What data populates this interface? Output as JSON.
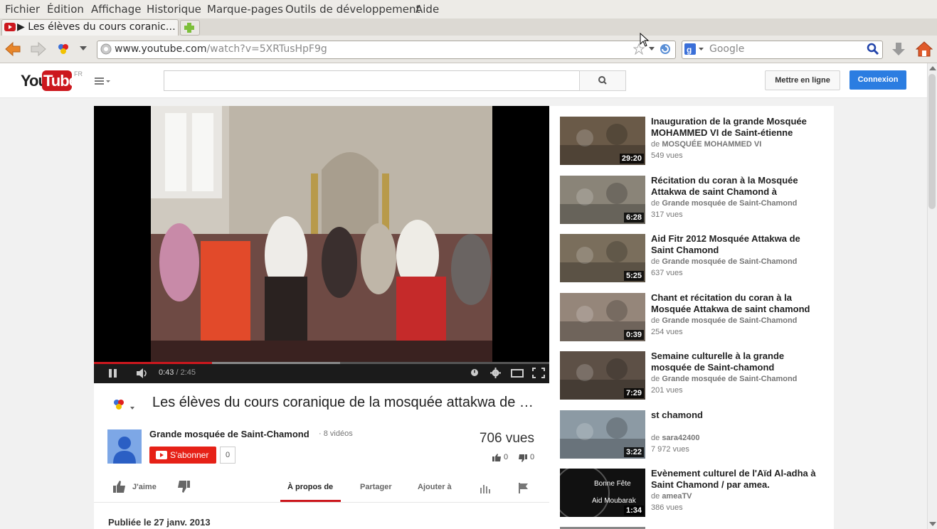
{
  "menubar": [
    "Fichier",
    "Édition",
    "Affichage",
    "Historique",
    "Marque-pages",
    "Outils de développement",
    "Aide"
  ],
  "tab": {
    "title": "▶ Les élèves du cours coranic…"
  },
  "navbar": {
    "url_host": "www.youtube.com",
    "url_path": "/watch?v=5XRTusHpF9g",
    "search_placeholder": "Google"
  },
  "yt": {
    "logo_you": "You",
    "logo_tube": "Tube",
    "region": "FR",
    "upload": "Mettre en ligne",
    "login": "Connexion"
  },
  "player": {
    "current": "0:43",
    "duration": "/ 2:45",
    "progress": 0.26,
    "buffered": 0.54
  },
  "video": {
    "title": "Les élèves du cours coranique de la mosquée attakwa de saint chamond",
    "channel": "Grande mosquée de Saint-Chamond",
    "video_count": "· 8 vidéos",
    "subscribe": "S'abonner",
    "sub_count": "0",
    "views": "706 vues",
    "likes": "0",
    "dislikes": "0",
    "like_label": "J'aime",
    "tabs": [
      "À propos de",
      "Partager",
      "Ajouter à"
    ],
    "published": "Publiée le 27 janv. 2013"
  },
  "recs": [
    {
      "title": "Inauguration de la grande Mosquée MOHAMMED VI de Saint-étienne",
      "by_prefix": "de",
      "by": "MOSQUÉE MOHAMMED VI",
      "views": "549 vues",
      "duration": "29:20",
      "thumb": "#6a5a48"
    },
    {
      "title": "Récitation du coran à la Mosquée Attakwa de saint Chamond à",
      "by_prefix": "de",
      "by": "Grande mosquée de Saint-Chamond",
      "views": "317 vues",
      "duration": "6:28",
      "thumb": "#8a8478"
    },
    {
      "title": "Aid Fitr 2012 Mosquée Attakwa de Saint Chamond",
      "by_prefix": "de",
      "by": "Grande mosquée de Saint-Chamond",
      "views": "637 vues",
      "duration": "5:25",
      "thumb": "#7a6e5c"
    },
    {
      "title": "Chant et récitation du coran à la Mosquée Attakwa de saint chamond",
      "by_prefix": "de",
      "by": "Grande mosquée de Saint-Chamond",
      "views": "254 vues",
      "duration": "0:39",
      "thumb": "#95867a"
    },
    {
      "title": "Semaine culturelle à la grande mosquée de Saint-chamond",
      "by_prefix": "de",
      "by": "Grande mosquée de Saint-Chamond",
      "views": "201 vues",
      "duration": "7:29",
      "thumb": "#5d5046"
    },
    {
      "title": "st chamond",
      "by_prefix": "de",
      "by": "sara42400",
      "views": "7 972 vues",
      "duration": "3:22",
      "thumb": "#8c9aa4"
    },
    {
      "title": "Evènement culturel de l'Aïd Al-adha à Saint Chamond / par amea.",
      "by_prefix": "de",
      "by": "ameaTV",
      "views": "386 vues",
      "duration": "1:34",
      "thumb": "#111111",
      "thumb_text1": "Bonne Fête",
      "thumb_text2": "Aid Moubarak"
    }
  ]
}
